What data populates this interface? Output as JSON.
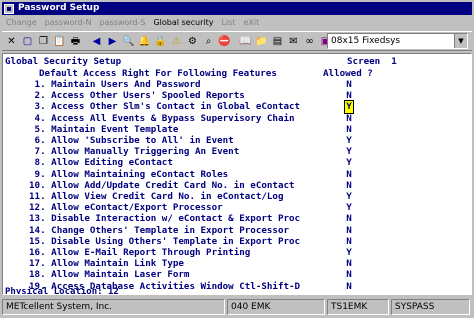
{
  "window": {
    "title": "Password Setup"
  },
  "menu": [
    {
      "label": "Change",
      "active": false
    },
    {
      "label": "password-N",
      "active": false
    },
    {
      "label": "password-S",
      "active": false
    },
    {
      "label": "Global security",
      "active": true
    },
    {
      "label": "List",
      "active": false
    },
    {
      "label": "eXit",
      "active": false
    }
  ],
  "toolbar": {
    "font_select_value": "08x15 Fixedsys",
    "buttons": [
      {
        "name": "close-icon",
        "glyph": "✕",
        "cls": ""
      },
      {
        "name": "new-icon",
        "glyph": "▢",
        "cls": "blue"
      },
      {
        "name": "copy-icon",
        "glyph": "❐",
        "cls": ""
      },
      {
        "name": "paste-icon",
        "glyph": "📋",
        "cls": ""
      },
      {
        "name": "print-icon",
        "glyph": "🖶",
        "cls": ""
      },
      {
        "name": "sep",
        "glyph": "",
        "cls": "sep"
      },
      {
        "name": "prev-icon",
        "glyph": "◀",
        "cls": "blue"
      },
      {
        "name": "next-icon",
        "glyph": "▶",
        "cls": "blue"
      },
      {
        "name": "find-icon",
        "glyph": "🔍",
        "cls": ""
      },
      {
        "name": "bell-icon",
        "glyph": "🔔",
        "cls": "yellow"
      },
      {
        "name": "lock-icon",
        "glyph": "🔒",
        "cls": ""
      },
      {
        "name": "warning-icon",
        "glyph": "⚠",
        "cls": "yellow"
      },
      {
        "name": "gear-icon",
        "glyph": "⚙",
        "cls": ""
      },
      {
        "name": "zoom-icon",
        "glyph": "⌕",
        "cls": ""
      },
      {
        "name": "stop-icon",
        "glyph": "⛔",
        "cls": "red"
      },
      {
        "name": "sep",
        "glyph": "",
        "cls": "sep"
      },
      {
        "name": "book-icon",
        "glyph": "📖",
        "cls": ""
      },
      {
        "name": "folder-icon",
        "glyph": "📁",
        "cls": "yellow"
      },
      {
        "name": "chart-icon",
        "glyph": "▤",
        "cls": ""
      },
      {
        "name": "email-icon",
        "glyph": "✉",
        "cls": ""
      },
      {
        "name": "link-icon",
        "glyph": "∞",
        "cls": ""
      },
      {
        "name": "image-icon",
        "glyph": "▣",
        "cls": "purple"
      },
      {
        "name": "sep",
        "glyph": "",
        "cls": "sep"
      },
      {
        "name": "calc-icon",
        "glyph": "▦",
        "cls": "blue"
      },
      {
        "name": "help-icon",
        "glyph": "?",
        "cls": "blue"
      }
    ]
  },
  "terminal": {
    "heading": "Global Security Setup",
    "screen_label": "Screen  1",
    "subheading": "Default Access Right For Following Features",
    "allowed_header": "Allowed ?",
    "rows": [
      {
        "num": " 1.",
        "text": "Maintain Users And Password",
        "value": "N"
      },
      {
        "num": " 2.",
        "text": "Access Other Users' Spooled Reports",
        "value": "N"
      },
      {
        "num": " 3.",
        "text": "Access Other Slm's Contact in Global eContact",
        "value": "Y"
      },
      {
        "num": " 4.",
        "text": "Access All Events & Bypass Supervisory Chain",
        "value": "N"
      },
      {
        "num": " 5.",
        "text": "Maintain Event Template",
        "value": "N"
      },
      {
        "num": " 6.",
        "text": "Allow 'Subscribe to All' in Event",
        "value": "Y"
      },
      {
        "num": " 7.",
        "text": "Allow Manually Triggering An Event",
        "value": "Y"
      },
      {
        "num": " 8.",
        "text": "Allow Editing eContact",
        "value": "Y"
      },
      {
        "num": " 9.",
        "text": "Allow Maintaining eContact Roles",
        "value": "N"
      },
      {
        "num": "10.",
        "text": "Allow Add/Update Credit Card No. in eContact",
        "value": "N"
      },
      {
        "num": "11.",
        "text": "Allow View Credit Card No. in eContact/Log",
        "value": "Y"
      },
      {
        "num": "12.",
        "text": "Allow eContact/Export Processor",
        "value": "Y"
      },
      {
        "num": "13.",
        "text": "Disable Interaction w/ eContact & Export Proc",
        "value": "N"
      },
      {
        "num": "14.",
        "text": "Change Others' Template in Export Processor",
        "value": "N"
      },
      {
        "num": "15.",
        "text": "Disable Using Others' Template in Export Proc",
        "value": "N"
      },
      {
        "num": "16.",
        "text": "Allow E-Mail Report Through Printing",
        "value": "Y"
      },
      {
        "num": "17.",
        "text": "Allow Maintain Link Type",
        "value": "N"
      },
      {
        "num": "18.",
        "text": "Allow Maintain Laser Form",
        "value": "N"
      },
      {
        "num": "19.",
        "text": "Access Database Activities Window Ctl-Shift-D",
        "value": "N"
      }
    ],
    "physical_location": "Physical Location: 12"
  },
  "status": {
    "company": "METcellent System, Inc.",
    "emulation": "040 EMK",
    "session": "TS1EMK",
    "program": "SYSPASS"
  }
}
